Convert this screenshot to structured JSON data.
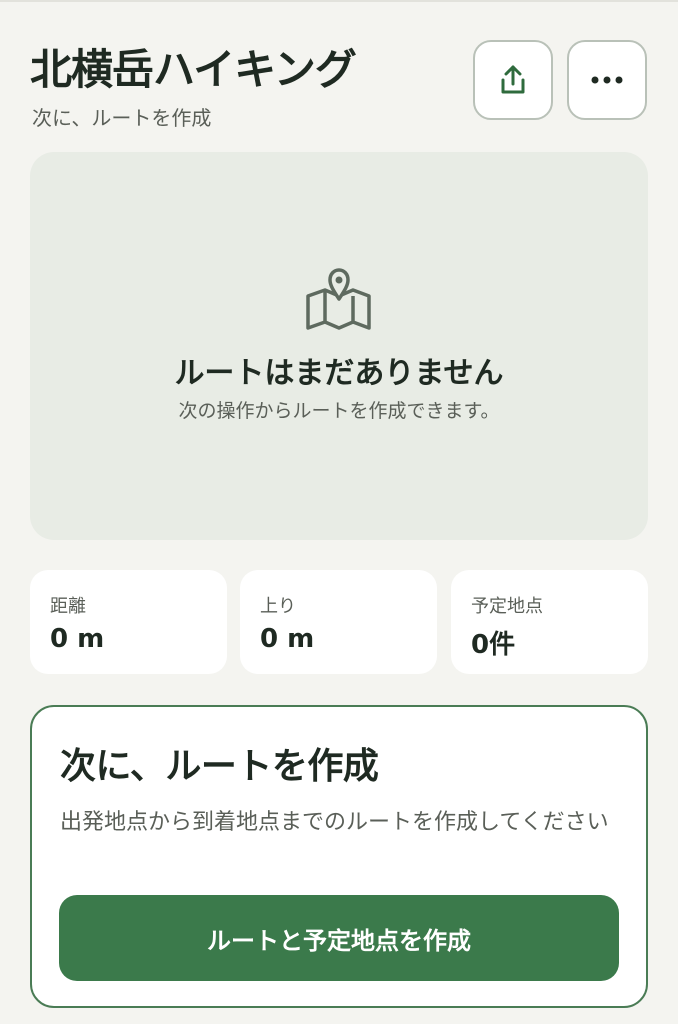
{
  "header": {
    "title": "北横岳ハイキング",
    "subtitle": "次に、ルートを作成",
    "share_icon": "share-icon",
    "more_icon": "more-horizontal-icon"
  },
  "map_empty": {
    "icon": "map-pin-icon",
    "title": "ルートはまだありません",
    "description": "次の操作からルートを作成できます。"
  },
  "stats": [
    {
      "label": "距離",
      "value": "0 m"
    },
    {
      "label": "上り",
      "value": "0 m"
    },
    {
      "label": "予定地点",
      "value": "0件"
    }
  ],
  "next_step": {
    "title": "次に、ルートを作成",
    "description": "出発地点から到着地点までのルートを作成してください",
    "button_label": "ルートと予定地点を作成"
  },
  "colors": {
    "background": "#f4f4f0",
    "accent": "#3b7a4b",
    "card_border": "#4a7c55",
    "map_bg": "#e8ece5"
  }
}
